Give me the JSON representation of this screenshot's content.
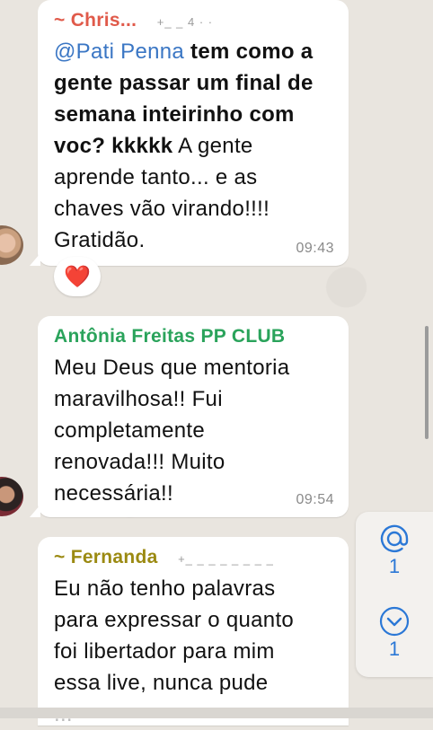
{
  "messages": [
    {
      "sender": "~ Chris...",
      "sender_color": "#e05a4a",
      "phone": "+_ _ 4 ·  ·    ",
      "mention": "@Pati Penna",
      "lines": [
        {
          "bold_tail": " tem como a"
        },
        {
          "bold": "gente passar um final de"
        },
        {
          "bold": "semana inteirinho com"
        },
        {
          "bold": "voc? kkkkk",
          "normal": "  A gente"
        },
        {
          "normal": "aprende tanto... e as"
        },
        {
          "normal": "chaves vão virando!!!!"
        },
        {
          "normal": "Gratidão."
        }
      ],
      "time": "09:43",
      "reaction": "❤️"
    },
    {
      "sender": "Antônia Freitas PP CLUB",
      "sender_color": "#2aa35b",
      "lines": [
        "Meu Deus que mentoria",
        "maravilhosa!! Fui",
        "completamente",
        "renovada!!! Muito",
        "necessária!!"
      ],
      "time": "09:54"
    },
    {
      "sender": "~ Fernanda",
      "sender_color": "#9b8a12",
      "phone": "+_ _  _ _ _ _  _ _",
      "lines": [
        "Eu não tenho palavras",
        "para expressar o quanto",
        "foi libertador para mim",
        "essa live, nunca pude",
        "..."
      ]
    }
  ],
  "side_panel": {
    "mentions": {
      "icon": "at-icon",
      "count": "1"
    },
    "scroll_down": {
      "icon": "chevron-down-icon",
      "count": "1"
    },
    "accent": "#2b78d6"
  }
}
